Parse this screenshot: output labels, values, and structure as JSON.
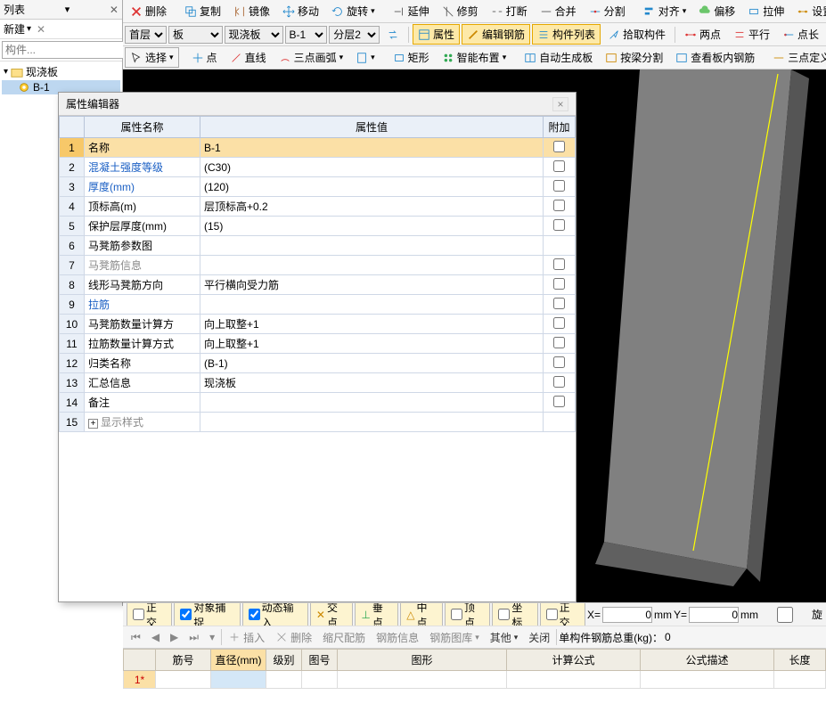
{
  "toolbar1": {
    "delete": "删除",
    "copy": "复制",
    "mirror": "镜像",
    "move": "移动",
    "rotate": "旋转",
    "extend": "延伸",
    "trim": "修剪",
    "break": "打断",
    "merge": "合并",
    "split": "分割",
    "align": "对齐",
    "offset": "偏移",
    "stretch": "拉伸",
    "setgrip": "设置夹点"
  },
  "toolbar2": {
    "layer_sel": "首层",
    "board_sel": "板",
    "cast_sel": "现浇板",
    "b1_sel": "B-1",
    "layer2_sel": "分层2",
    "props": "属性",
    "editrebar": "编辑钢筋",
    "complist": "构件列表",
    "pickcomp": "拾取构件",
    "twopoint": "两点",
    "parallel": "平行",
    "pointlong": "点长"
  },
  "toolbar3": {
    "select": "选择",
    "point": "点",
    "line": "直线",
    "arc3": "三点画弧",
    "rect": "矩形",
    "smart": "智能布置",
    "autogen": "自动生成板",
    "splitbeam": "按梁分割",
    "viewrebar": "查看板内钢筋",
    "threept": "三点定义"
  },
  "left": {
    "list_title": "列表",
    "new": "新建",
    "search_ph": "构件...",
    "tree_root": "现浇板",
    "tree_child": "B-1"
  },
  "dialog": {
    "title": "属性编辑器",
    "col_name": "属性名称",
    "col_value": "属性值",
    "col_attach": "附加",
    "rows": [
      {
        "n": "1",
        "name": "名称",
        "value": "B-1",
        "link": false,
        "check": true,
        "sel": true
      },
      {
        "n": "2",
        "name": "混凝土强度等级",
        "value": "(C30)",
        "link": true,
        "check": true
      },
      {
        "n": "3",
        "name": "厚度(mm)",
        "value": "(120)",
        "link": true,
        "check": true
      },
      {
        "n": "4",
        "name": "顶标高(m)",
        "value": "层顶标高+0.2",
        "link": false,
        "check": true
      },
      {
        "n": "5",
        "name": "保护层厚度(mm)",
        "value": "(15)",
        "link": false,
        "check": true
      },
      {
        "n": "6",
        "name": "马凳筋参数图",
        "value": "",
        "link": false,
        "check": false
      },
      {
        "n": "7",
        "name": "马凳筋信息",
        "value": "",
        "link": false,
        "check": true,
        "gray": true
      },
      {
        "n": "8",
        "name": "线形马凳筋方向",
        "value": "平行横向受力筋",
        "link": false,
        "check": true
      },
      {
        "n": "9",
        "name": "拉筋",
        "value": "",
        "link": true,
        "check": true
      },
      {
        "n": "10",
        "name": "马凳筋数量计算方",
        "value": "向上取整+1",
        "link": false,
        "check": true
      },
      {
        "n": "11",
        "name": "拉筋数量计算方式",
        "value": "向上取整+1",
        "link": false,
        "check": true
      },
      {
        "n": "12",
        "name": "归类名称",
        "value": "(B-1)",
        "link": false,
        "check": true
      },
      {
        "n": "13",
        "name": "汇总信息",
        "value": "现浇板",
        "link": false,
        "check": true
      },
      {
        "n": "14",
        "name": "备注",
        "value": "",
        "link": false,
        "check": true
      },
      {
        "n": "15",
        "name": "显示样式",
        "value": "",
        "link": false,
        "check": false,
        "expand": true,
        "gray": true
      }
    ]
  },
  "bottombar": {
    "tabs": [
      "正交",
      "对象捕捉",
      "动态输入",
      "交点",
      "垂点",
      "中点",
      "顶点",
      "坐标",
      "正交"
    ],
    "X": "X=",
    "Xv": "0",
    "Xu": "mm",
    "Y": "Y=",
    "Yv": "0",
    "Yu": "mm",
    "rot": "旋"
  },
  "bottomtoolbar": {
    "insert": "插入",
    "delete": "删除",
    "scale": "缩尺配筋",
    "rebarinfo": "钢筋信息",
    "rebarlib": "钢筋图库",
    "other": "其他",
    "close": "关闭",
    "weight_label": "单构件钢筋总重(kg)：",
    "weight": "0"
  },
  "rebar_table": {
    "headers": [
      "",
      "筋号",
      "直径(mm)",
      "级别",
      "图号",
      "图形",
      "计算公式",
      "公式描述",
      "长度"
    ],
    "row1": "1*"
  }
}
